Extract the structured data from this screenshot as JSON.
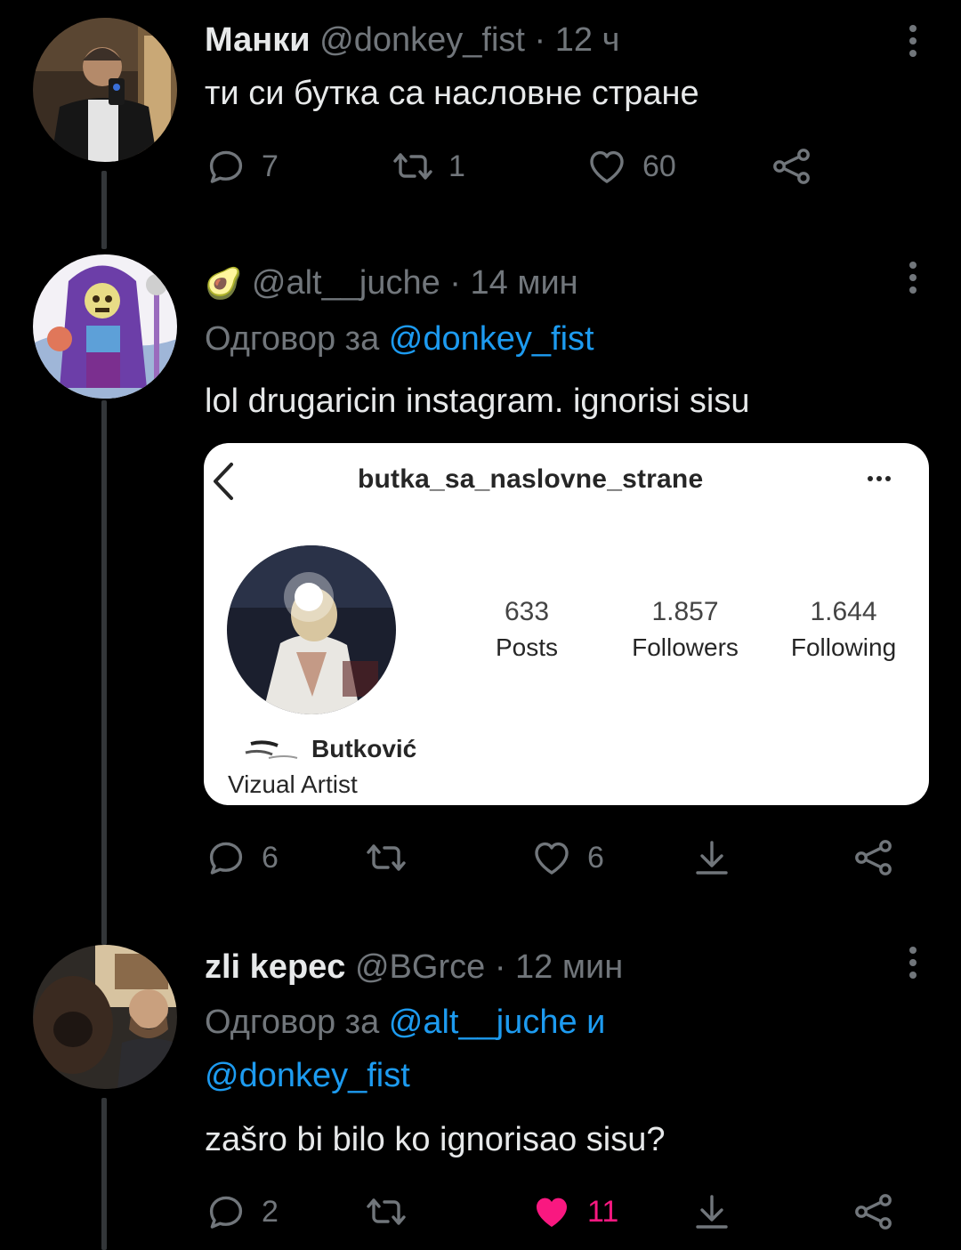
{
  "tweets": [
    {
      "display_name": "Манки",
      "handle": "@donkey_fist",
      "time": "· 12 ч",
      "text": "ти си бутка са насловне стране",
      "replies": "7",
      "retweets": "1",
      "likes": "60"
    },
    {
      "emoji": "🥑",
      "handle": "@alt__juche",
      "time": "· 14 мин",
      "reply_prefix": "Одговор за",
      "reply_to": "@donkey_fist",
      "text": "lol drugaricin instagram. ignorisi sisu",
      "replies": "6",
      "likes": "6",
      "embed": {
        "username": "butka_sa_naslovne_strane",
        "posts_value": "633",
        "posts_label": "Posts",
        "followers_value": "1.857",
        "followers_label": "Followers",
        "following_value": "1.644",
        "following_label": "Following",
        "name": "Butković",
        "bio": "Vizual Artist"
      }
    },
    {
      "display_name": "zli kepec",
      "handle": "@BGrce",
      "time": "· 12 мин",
      "reply_prefix": "Одговор за",
      "reply_to_1": "@alt__juche",
      "reply_joiner": "и",
      "reply_to_2": "@donkey_fist",
      "text": "zašro bi bilo ko ignorisao sisu?",
      "replies": "2",
      "likes": "11",
      "liked": true
    }
  ],
  "icons": [
    "reply-icon",
    "retweet-icon",
    "like-icon",
    "share-icon",
    "bookmark-icon",
    "more-icon",
    "back-icon"
  ],
  "colors": {
    "background": "#000000",
    "text": "#e7e9ea",
    "muted": "#71767b",
    "link": "#1d9bf0",
    "liked": "#f91880"
  }
}
